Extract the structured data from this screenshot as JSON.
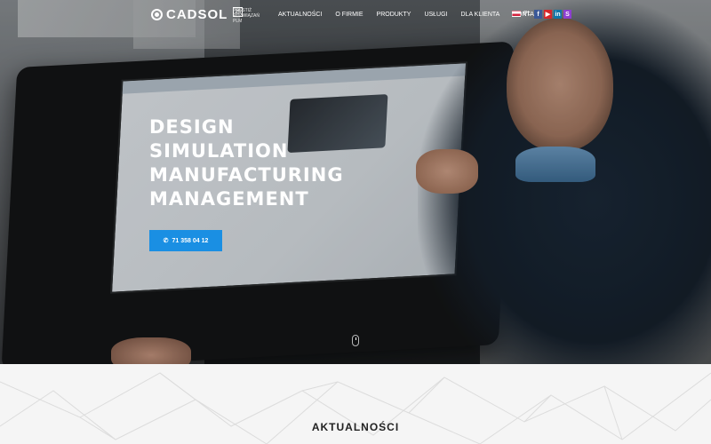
{
  "header": {
    "logo_text": "CADSOL",
    "logo_badge": "25",
    "tagline": "PRESTIŻ ROZWIĄZAŃ PLM",
    "nav": [
      "AKTUALNOŚCI",
      "O FIRMIE",
      "PRODUKTY",
      "USŁUGI",
      "DLA KLIENTA",
      "KONTAKT"
    ],
    "language": "PL",
    "social": [
      {
        "icon": "facebook-icon",
        "glyph": "f",
        "color": "#3b5998"
      },
      {
        "icon": "youtube-icon",
        "glyph": "▶",
        "color": "#d6262a"
      },
      {
        "icon": "linkedin-icon",
        "glyph": "in",
        "color": "#0e76a8"
      },
      {
        "icon": "s-icon",
        "glyph": "S",
        "color": "#8e3fd1"
      }
    ]
  },
  "hero": {
    "headline": [
      "DESIGN",
      "SIMULATION",
      "MANUFACTURING",
      "MANAGEMENT"
    ],
    "phone_label": "71 358 04 12",
    "accent_color": "#1a8fe3"
  },
  "news": {
    "title": "AKTUALNOŚCI"
  }
}
